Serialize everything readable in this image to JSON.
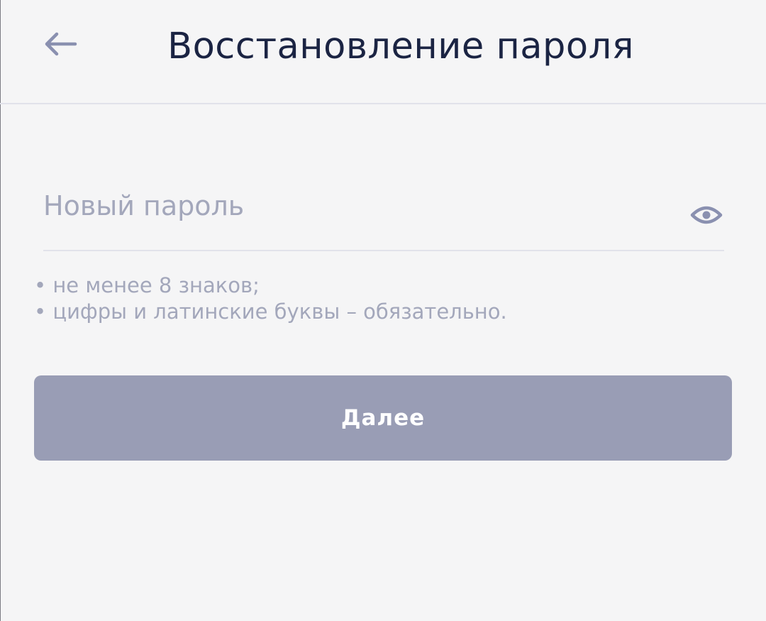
{
  "header": {
    "title": "Восстановление пароля",
    "back_icon": "arrow-left-icon"
  },
  "password_field": {
    "value": "",
    "placeholder": "Новый пароль",
    "toggle_icon": "eye-icon"
  },
  "hints": [
    "• не менее 8 знаков;",
    "• цифры и латинские буквы – обязательно."
  ],
  "next_button": {
    "label": "Далее",
    "enabled": false
  },
  "colors": {
    "background": "#f5f5f6",
    "title": "#1b2443",
    "muted": "#a3a7bb",
    "icon": "#8a90b0",
    "divider": "#e1e2ea",
    "button_disabled": "#999db5",
    "button_text": "#ffffff"
  }
}
